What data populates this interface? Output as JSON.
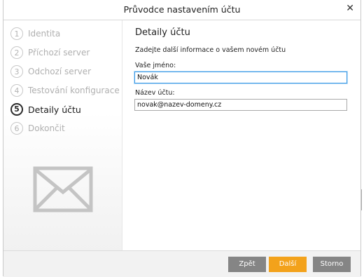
{
  "window": {
    "title": "Průvodce nastavením účtu",
    "close_glyph": "✕"
  },
  "sidebar": {
    "steps": [
      {
        "num": "1",
        "label": "Identita",
        "state": "done"
      },
      {
        "num": "2",
        "label": "Příchozí server",
        "state": "done"
      },
      {
        "num": "3",
        "label": "Odchozí server",
        "state": "done"
      },
      {
        "num": "4",
        "label": "Testování konfigurace",
        "state": "done"
      },
      {
        "num": "5",
        "label": "Detaily účtu",
        "state": "active"
      },
      {
        "num": "6",
        "label": "Dokončit",
        "state": "pending"
      }
    ],
    "illustration": "envelope-icon"
  },
  "main": {
    "heading": "Detaily účtu",
    "intro": "Zadejte další informace o vašem novém účtu",
    "name_label": "Vaše jméno:",
    "name_value": "Novák",
    "account_label": "Název účtu:",
    "account_value": "novak@nazev-domeny.cz"
  },
  "footer": {
    "back_label": "Zpět",
    "next_label": "Další",
    "cancel_label": "Storno"
  },
  "colors": {
    "accent": "#f3a21b",
    "button_gray": "#858585",
    "focus_border": "#3d9be6"
  }
}
